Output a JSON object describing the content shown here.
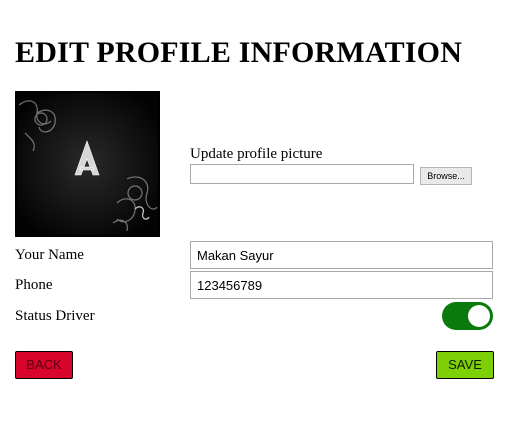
{
  "header": {
    "title": "EDIT PROFILE INFORMATION"
  },
  "profile_picture": {
    "icon": "profile-image",
    "upload_label": "Update profile picture",
    "file_value": "",
    "browse_label": "Browse..."
  },
  "fields": {
    "name_label": "Your Name",
    "name_value": "Makan Sayur",
    "phone_label": "Phone",
    "phone_value": "123456789",
    "status_label": "Status Driver",
    "status_on": true
  },
  "actions": {
    "back_label": "BACK",
    "save_label": "SAVE"
  },
  "colors": {
    "toggle_on": "#0a7a0c",
    "back_button": "#d9042b",
    "save_button": "#7ed006"
  }
}
